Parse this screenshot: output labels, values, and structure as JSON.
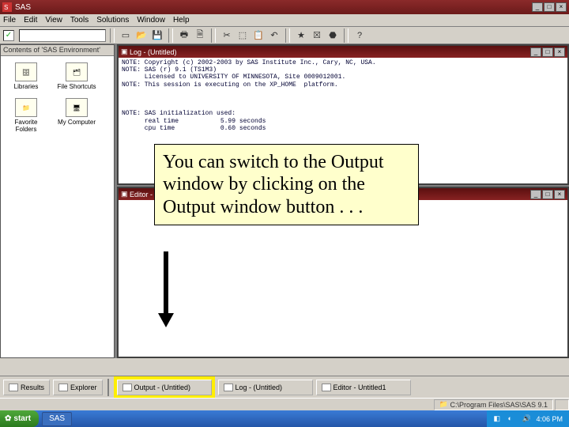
{
  "app": {
    "title": "SAS",
    "menus": [
      "File",
      "Edit",
      "View",
      "Tools",
      "Solutions",
      "Window",
      "Help"
    ]
  },
  "toolbar": {
    "search_value": ""
  },
  "explorer": {
    "heading": "Contents of 'SAS Environment'",
    "items": [
      {
        "label": "Libraries"
      },
      {
        "label": "File Shortcuts"
      },
      {
        "label": "Favorite Folders"
      },
      {
        "label": "My Computer"
      }
    ]
  },
  "log_window": {
    "title": "Log - (Untitled)",
    "text": "NOTE: Copyright (c) 2002-2003 by SAS Institute Inc., Cary, NC, USA.\nNOTE: SAS (r) 9.1 (TS1M3)\n      Licensed to UNIVERSITY OF MINNESOTA, Site 0009012001.\nNOTE: This session is executing on the XP_HOME  platform.\n\n\n\nNOTE: SAS initialization used:\n      real time           5.99 seconds\n      cpu time            0.60 seconds"
  },
  "editor_window": {
    "title": "Editor - Untitled1"
  },
  "callout": {
    "text": "You can switch to the Output window by clicking on the Output window button . . ."
  },
  "window_tabs": {
    "left": [
      {
        "label": "Results"
      },
      {
        "label": "Explorer"
      }
    ],
    "right": [
      {
        "label": "Output - (Untitled)",
        "highlight": true
      },
      {
        "label": "Log - (Untitled)"
      },
      {
        "label": "Editor - Untitled1"
      }
    ]
  },
  "statusbar": {
    "path": "C:\\Program Files\\SAS\\SAS 9.1"
  },
  "taskbar": {
    "start": "start",
    "items": [
      {
        "label": "SAS"
      }
    ],
    "clock": "4:06 PM"
  }
}
